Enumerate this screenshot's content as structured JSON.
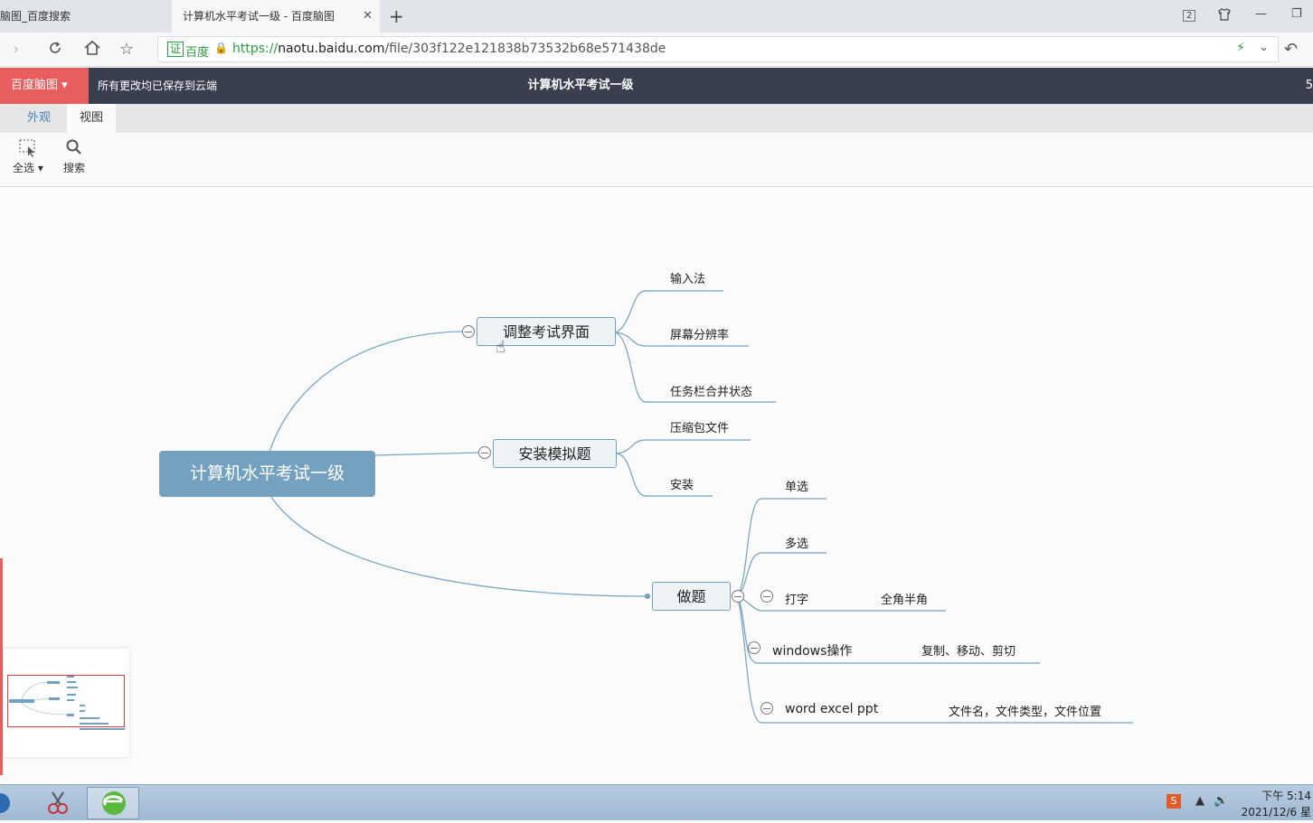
{
  "browser": {
    "tabs": [
      {
        "label": "脑图_百度搜索"
      },
      {
        "label": "计算机水平考试一级 - 百度脑图"
      }
    ],
    "new_tab_icon": "plus-icon",
    "address": {
      "cert_label": "证",
      "cert_name": "百度",
      "url_scheme": "https://",
      "url_host": "naotu.baidu.com",
      "url_path": "/file/303f122e121838b73532b68e571438de"
    },
    "window_badge": "2"
  },
  "app": {
    "brand_button": "百度脑图 ▾",
    "save_status": "所有更改均已保存到云端",
    "title": "计算机水平考试一级",
    "right_fragment": "5"
  },
  "ribbon": {
    "tabs": [
      {
        "label": "外观"
      },
      {
        "label": "视图"
      }
    ],
    "tools": [
      {
        "label": "全选 ▾",
        "icon": "select-all-icon"
      },
      {
        "label": "搜索",
        "icon": "search-icon"
      }
    ]
  },
  "mindmap": {
    "root": "计算机水平考试一级",
    "branches": [
      {
        "label": "调整考试界面",
        "children": [
          "输入法",
          "屏幕分辨率",
          "任务栏合并状态"
        ]
      },
      {
        "label": "安装模拟题",
        "children": [
          "压缩包文件",
          "安装"
        ]
      },
      {
        "label": "做题",
        "children": [
          {
            "label": "单选"
          },
          {
            "label": "多选"
          },
          {
            "label": "打字",
            "child": "全角半角"
          },
          {
            "label": "windows操作",
            "child": "复制、移动、剪切"
          },
          {
            "label": "word excel ppt",
            "child": "文件名，文件类型，文件位置"
          }
        ]
      }
    ]
  },
  "colors": {
    "accent": "#e85d5d",
    "header": "#393f4f",
    "root_node": "#73a1bf",
    "connector": "#73a1bf"
  },
  "taskbar": {
    "clock_time": "下午 5:14",
    "clock_date": "2021/12/6 星"
  }
}
